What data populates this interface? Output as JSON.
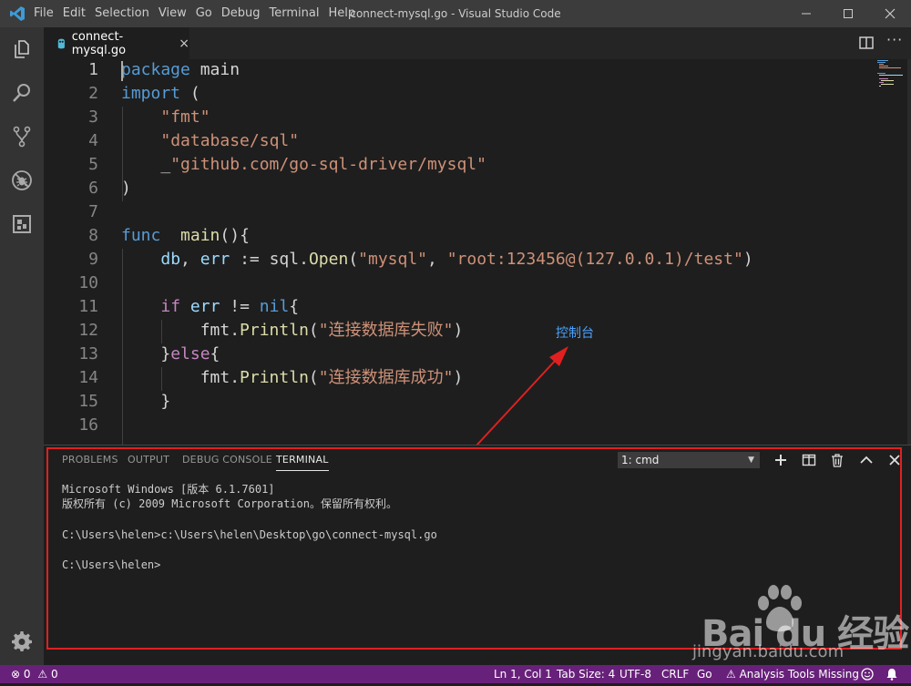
{
  "app": {
    "window_title": "connect-mysql.go - Visual Studio Code",
    "menu": [
      "File",
      "Edit",
      "Selection",
      "View",
      "Go",
      "Debug",
      "Terminal",
      "Help"
    ]
  },
  "activity_bar": {
    "items": [
      "explorer-icon",
      "search-icon",
      "source-control-icon",
      "debug-icon",
      "extensions-icon"
    ],
    "bottom": "gear-icon"
  },
  "tab": {
    "label": "connect-mysql.go",
    "close": "×"
  },
  "editor": {
    "line_numbers": [
      "1",
      "2",
      "3",
      "4",
      "5",
      "6",
      "7",
      "8",
      "9",
      "10",
      "11",
      "12",
      "13",
      "14",
      "15",
      "16"
    ],
    "lines": [
      {
        "t": [
          {
            "c": "kw",
            "s": "package"
          },
          {
            "c": "tx",
            "s": " main"
          }
        ]
      },
      {
        "t": [
          {
            "c": "kw",
            "s": "import"
          },
          {
            "c": "tx",
            "s": " ("
          }
        ]
      },
      {
        "t": [
          {
            "c": "tx",
            "s": "    "
          },
          {
            "c": "str",
            "s": "\"fmt\""
          }
        ]
      },
      {
        "t": [
          {
            "c": "tx",
            "s": "    "
          },
          {
            "c": "str",
            "s": "\"database/sql\""
          }
        ]
      },
      {
        "t": [
          {
            "c": "tx",
            "s": "    _"
          },
          {
            "c": "str",
            "s": "\"github.com/go-sql-driver/mysql\""
          }
        ]
      },
      {
        "t": [
          {
            "c": "tx",
            "s": ")"
          }
        ]
      },
      {
        "t": []
      },
      {
        "t": [
          {
            "c": "kw",
            "s": "func"
          },
          {
            "c": "tx",
            "s": "  "
          },
          {
            "c": "fn",
            "s": "main"
          },
          {
            "c": "tx",
            "s": "(){"
          }
        ]
      },
      {
        "t": [
          {
            "c": "tx",
            "s": "    "
          },
          {
            "c": "var",
            "s": "db"
          },
          {
            "c": "tx",
            "s": ", "
          },
          {
            "c": "var",
            "s": "err"
          },
          {
            "c": "tx",
            "s": " := sql."
          },
          {
            "c": "fn",
            "s": "Open"
          },
          {
            "c": "tx",
            "s": "("
          },
          {
            "c": "str",
            "s": "\"mysql\""
          },
          {
            "c": "tx",
            "s": ", "
          },
          {
            "c": "str",
            "s": "\"root:123456@(127.0.0.1)/test\""
          },
          {
            "c": "tx",
            "s": ")"
          }
        ]
      },
      {
        "t": []
      },
      {
        "t": [
          {
            "c": "tx",
            "s": "    "
          },
          {
            "c": "kw2",
            "s": "if"
          },
          {
            "c": "tx",
            "s": " "
          },
          {
            "c": "var",
            "s": "err"
          },
          {
            "c": "tx",
            "s": " != "
          },
          {
            "c": "kw",
            "s": "nil"
          },
          {
            "c": "tx",
            "s": "{"
          }
        ]
      },
      {
        "t": [
          {
            "c": "tx",
            "s": "        fmt."
          },
          {
            "c": "fn",
            "s": "Println"
          },
          {
            "c": "tx",
            "s": "("
          },
          {
            "c": "str",
            "s": "\"连接数据库失败\""
          },
          {
            "c": "tx",
            "s": ")"
          }
        ]
      },
      {
        "t": [
          {
            "c": "tx",
            "s": "    }"
          },
          {
            "c": "kw2",
            "s": "else"
          },
          {
            "c": "tx",
            "s": "{"
          }
        ]
      },
      {
        "t": [
          {
            "c": "tx",
            "s": "        fmt."
          },
          {
            "c": "fn",
            "s": "Println"
          },
          {
            "c": "tx",
            "s": "("
          },
          {
            "c": "str",
            "s": "\"连接数据库成功\""
          },
          {
            "c": "tx",
            "s": ")"
          }
        ]
      },
      {
        "t": [
          {
            "c": "tx",
            "s": "    }"
          }
        ]
      },
      {
        "t": []
      }
    ]
  },
  "annotation": {
    "label": "控制台"
  },
  "panel": {
    "tabs": [
      "PROBLEMS",
      "OUTPUT",
      "DEBUG CONSOLE",
      "TERMINAL"
    ],
    "active_tab": "TERMINAL",
    "terminal_select": "1: cmd",
    "terminal_lines": [
      "Microsoft Windows [版本 6.1.7601]",
      "版权所有 (c) 2009 Microsoft Corporation。保留所有权利。",
      "",
      "C:\\Users\\helen>c:\\Users\\helen\\Desktop\\go\\connect-mysql.go",
      "",
      "C:\\Users\\helen>"
    ]
  },
  "status_bar": {
    "errors": "0",
    "warnings": "0",
    "position": "Ln 1, Col 1",
    "tab_size": "Tab Size: 4",
    "encoding": "UTF-8",
    "eol": "CRLF",
    "language": "Go",
    "analysis": "Analysis Tools Missing"
  },
  "watermark": {
    "brand": "Bai du 经验",
    "url": "jingyan.baidu.com"
  },
  "colors": {
    "status_bar": "#68217a",
    "accent_blue": "#569cd6",
    "annotation": "#4aa3ff",
    "highlight_box": "#e02020"
  }
}
